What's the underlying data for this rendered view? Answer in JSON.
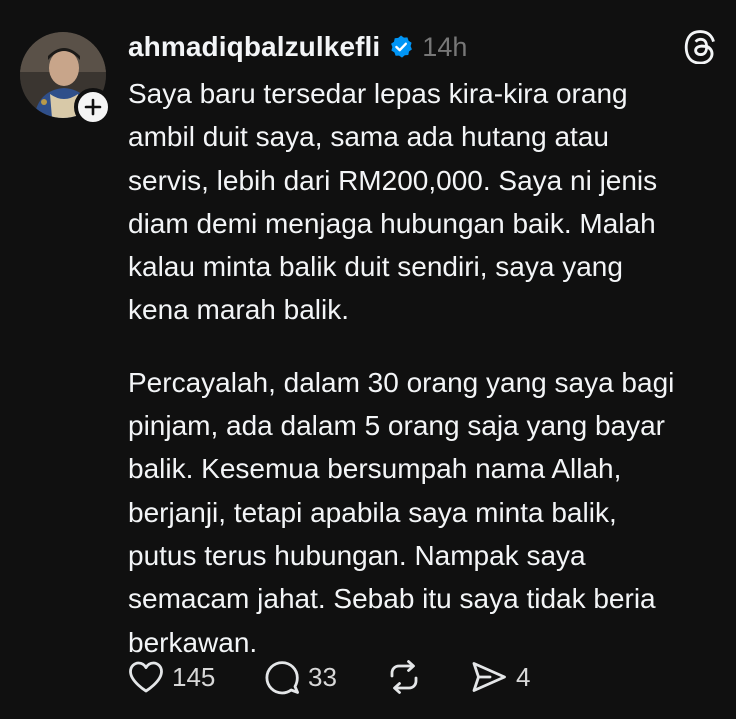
{
  "post": {
    "username": "ahmadiqbalzulkefli",
    "time": "14h",
    "paragraphs": [
      "Saya baru tersedar lepas kira-kira orang\nambil duit saya, sama ada hutang atau\nservis, lebih dari RM200,000. Saya ni jenis\ndiam demi menjaga hubungan baik. Malah\nkalau minta balik duit sendiri, saya yang\nkena marah balik.",
      "Percayalah, dalam 30 orang yang saya bagi\npinjam, ada dalam 5 orang saja yang bayar\nbalik. Kesemua bersumpah nama Allah,\nberjanji, tetapi apabila saya minta balik,\nputus terus hubungan. Nampak saya\nsemacam jahat. Sebab itu saya tidak beria\nberkawan."
    ],
    "actions": {
      "likes": "145",
      "replies": "33",
      "shares": "4"
    }
  },
  "icons": {
    "avatar": "avatar-photo",
    "follow": "plus-icon",
    "verified": "verified-badge-icon",
    "logo": "threads-logo-icon",
    "like": "heart-icon",
    "reply": "comment-bubble-icon",
    "repost": "repost-icon",
    "share": "send-icon"
  },
  "colors": {
    "background": "#101010",
    "text": "#f3f5f7",
    "muted": "#777777",
    "verified": "#0095f6"
  }
}
